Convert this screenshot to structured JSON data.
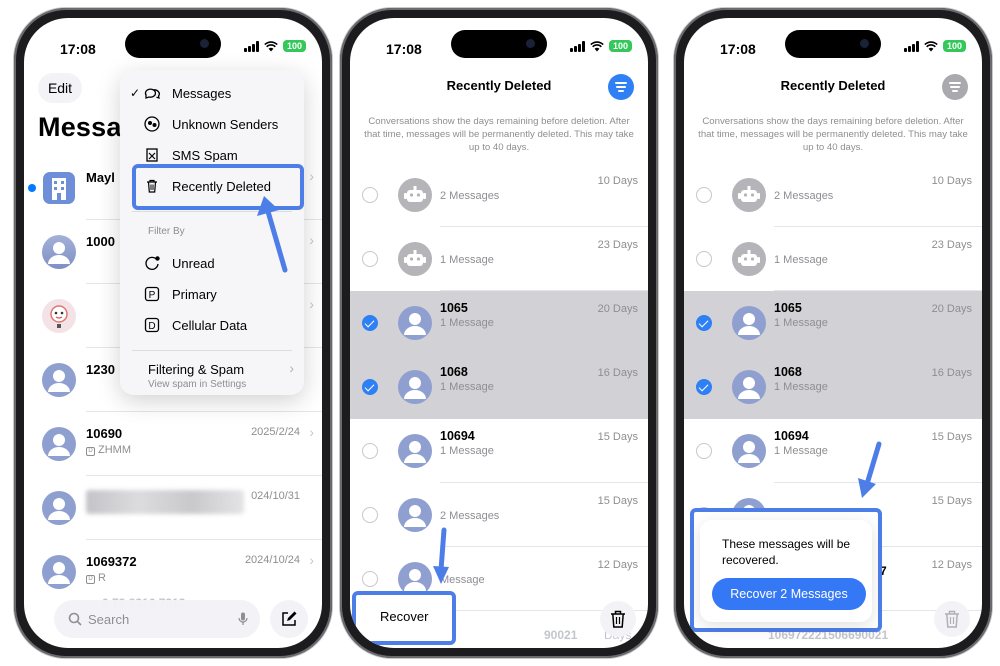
{
  "status": {
    "time": "17:08",
    "battery": "100"
  },
  "phone1": {
    "edit_label": "Edit",
    "title_fragment": "Messa",
    "menu": {
      "items": [
        "Messages",
        "Unknown Senders",
        "SMS Spam",
        "Recently Deleted"
      ],
      "filter_header": "Filter By",
      "filters": [
        "Unread",
        "Primary",
        "Cellular Data"
      ],
      "filtering_title": "Filtering & Spam",
      "filtering_sub": "View spam in Settings"
    },
    "conversations": [
      {
        "name": "Mayl",
        "sub": "",
        "date": ""
      },
      {
        "name": "1000",
        "sub": "",
        "date": ""
      },
      {
        "name": "",
        "sub": "",
        "date": ""
      },
      {
        "name": "1230",
        "sub": "",
        "date": ""
      },
      {
        "name": "10690",
        "sub": "ZHMM",
        "date": "2025/2/24"
      },
      {
        "name": "",
        "sub": "",
        "date": "024/10/31"
      },
      {
        "name": "1069372",
        "sub": "R",
        "date": "2024/10/24"
      }
    ],
    "search_placeholder": "Search",
    "ghost_text": "0 78 8316 7312"
  },
  "phone2": {
    "title": "Recently Deleted",
    "note": "Conversations show the days remaining before deletion. After that time, messages will be permanently deleted. This may take up to 40 days.",
    "rows": [
      {
        "name": "",
        "sub": "2 Messages",
        "days": "10 Days",
        "selected": false,
        "bot": true
      },
      {
        "name": "",
        "sub": "1 Message",
        "days": "23 Days",
        "selected": false,
        "bot": true
      },
      {
        "name": "1065",
        "sub": "1 Message",
        "days": "20 Days",
        "selected": true,
        "bot": false
      },
      {
        "name": "1068",
        "sub": "1 Message",
        "days": "16 Days",
        "selected": true,
        "bot": false
      },
      {
        "name": "10694",
        "sub": "1 Message",
        "days": "15 Days",
        "selected": false,
        "bot": false
      },
      {
        "name": "",
        "sub": "2 Messages",
        "days": "15 Days",
        "selected": false,
        "bot": false
      },
      {
        "name": "",
        "sub": "Message",
        "days": "12 Days",
        "selected": false,
        "bot": false
      }
    ],
    "recover_label": "Recover",
    "ghost_text": "90021",
    "ghost_days": "Days"
  },
  "phone3": {
    "title": "Recently Deleted",
    "dialog_text": "These messages will be recovered.",
    "dialog_button": "Recover 2 Messages",
    "partial_name": "7",
    "ghost_text": "106972221506690021"
  },
  "colors": {
    "accent": "#4d7ee8",
    "blue": "#3478f6",
    "selected_row": "#d1d1d6"
  }
}
